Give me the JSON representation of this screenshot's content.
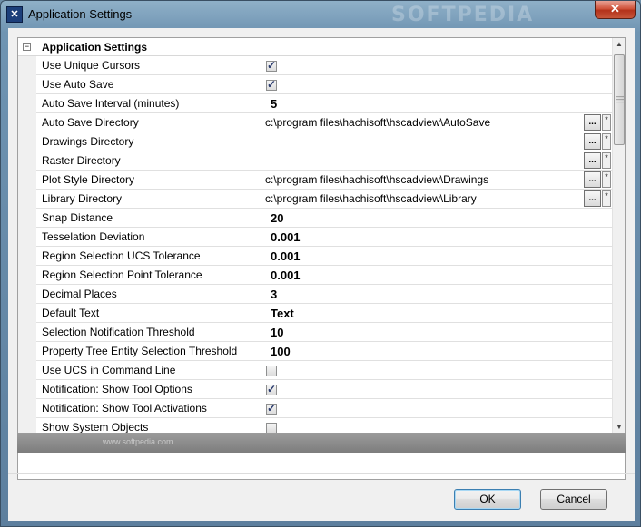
{
  "window": {
    "title": "Application Settings",
    "watermark": "SOFTPEDIA",
    "close_label": "✕"
  },
  "grid": {
    "category": {
      "label": "Application Settings",
      "expander": "−"
    },
    "rows": [
      {
        "name": "Use Unique Cursors",
        "type": "checkbox",
        "checked": true
      },
      {
        "name": "Use Auto Save",
        "type": "checkbox",
        "checked": true
      },
      {
        "name": "Auto Save Interval (minutes)",
        "type": "bold",
        "value": "5"
      },
      {
        "name": "Auto Save Directory",
        "type": "path",
        "value": "c:\\program files\\hachisoft\\hscadview\\AutoSave"
      },
      {
        "name": "Drawings Directory",
        "type": "path",
        "value": ""
      },
      {
        "name": "Raster Directory",
        "type": "path",
        "value": ""
      },
      {
        "name": "Plot Style Directory",
        "type": "path",
        "value": "c:\\program files\\hachisoft\\hscadview\\Drawings"
      },
      {
        "name": "Library Directory",
        "type": "path",
        "value": "c:\\program files\\hachisoft\\hscadview\\Library"
      },
      {
        "name": "Snap Distance",
        "type": "bold",
        "value": "20"
      },
      {
        "name": "Tesselation Deviation",
        "type": "bold",
        "value": "0.001"
      },
      {
        "name": "Region Selection UCS Tolerance",
        "type": "bold",
        "value": "0.001"
      },
      {
        "name": "Region Selection Point Tolerance",
        "type": "bold",
        "value": "0.001"
      },
      {
        "name": "Decimal Places",
        "type": "bold",
        "value": "3"
      },
      {
        "name": "Default Text",
        "type": "bold",
        "value": "Text"
      },
      {
        "name": "Selection Notification Threshold",
        "type": "bold",
        "value": "10"
      },
      {
        "name": "Property Tree Entity Selection Threshold",
        "type": "bold",
        "value": "100"
      },
      {
        "name": "Use UCS in Command Line",
        "type": "checkbox",
        "checked": false
      },
      {
        "name": "Notification: Show Tool Options",
        "type": "checkbox",
        "checked": true
      },
      {
        "name": "Notification: Show Tool Activations",
        "type": "checkbox",
        "checked": true
      },
      {
        "name": "Show System Objects",
        "type": "checkbox",
        "checked": false
      }
    ],
    "browse_label": "...",
    "pin_label": "*"
  },
  "description": {
    "watermark": "www.softpedia.com"
  },
  "buttons": {
    "ok": "OK",
    "cancel": "Cancel"
  }
}
